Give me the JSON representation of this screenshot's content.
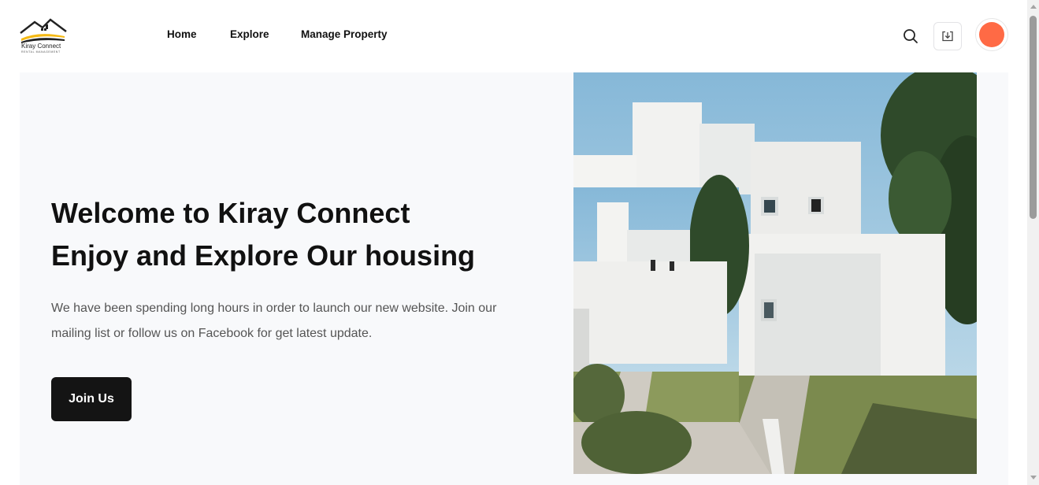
{
  "brand": {
    "name": "Kiray Connect",
    "tagline": "RENTAL MANAGEMENT"
  },
  "nav": {
    "items": [
      {
        "label": "Home"
      },
      {
        "label": "Explore"
      },
      {
        "label": "Manage Property"
      }
    ]
  },
  "header_actions": {
    "search_icon": "search-icon",
    "download_icon": "download-icon",
    "avatar_color": "#ff6a45"
  },
  "hero": {
    "title_line1": "Welcome to Kiray Connect",
    "title_line2": "Enjoy and Explore Our housing",
    "description": "We have been spending long hours in order to launch our new website. Join our mailing list or follow us on Facebook for get latest update.",
    "cta_label": "Join Us"
  },
  "colors": {
    "accent": "#ff6a45",
    "button_bg": "#141414",
    "hero_bg": "#f8f9fb"
  }
}
